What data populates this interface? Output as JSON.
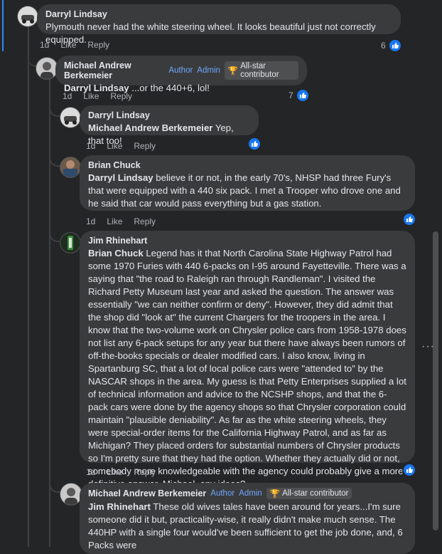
{
  "comments": [
    {
      "author": "Darryl Lindsay",
      "text": "Plymouth never had the white steering wheel. It looks beautiful just not correctly equipped.",
      "time": "1d",
      "like": "Like",
      "reply": "Reply",
      "reactions": "6"
    },
    {
      "author": "Michael Andrew Berkemeier",
      "badge_author": "Author",
      "badge_admin": "Admin",
      "badge_allstar": "All-star contributor",
      "mention": "Darryl Lindsay",
      "text": " ...or the 440+6, lol!",
      "time": "1d",
      "like": "Like",
      "reply": "Reply",
      "reactions": "7"
    },
    {
      "author": "Darryl Lindsay",
      "mention": "Michael Andrew Berkemeier",
      "text": " Yep, that too!",
      "time": "1d",
      "like": "Like",
      "reply": "Reply"
    },
    {
      "author": "Brian Chuck",
      "mention": "Darryl Lindsay",
      "text": " believe it or not, in the early 70's, NHSP had three Fury's that were equipped with a 440 six pack. I met a Trooper who drove one and he said that car would pass everything but a gas station.",
      "time": "1d",
      "like": "Like",
      "reply": "Reply"
    },
    {
      "author": "Jim Rhinehart",
      "mention": "Brian Chuck",
      "text": " Legend has it that North Carolina State Highway Patrol had some 1970 Furies with 440 6-packs on I-95 around Fayetteville. There was a saying that \"the road to Raleigh ran through Randleman\". I visited the Richard Petty Museum last year and asked the question. The answer was essentially \"we can neither confirm or deny\". However, they did admit that the shop did \"look at\" the current Chargers for the troopers in the area. I know that the two-volume work on Chrysler police cars from 1958-1978 does not list any 6-pack setups for any year but there have always been rumors of off-the-books specials or dealer modified cars. I also know, living in Spartanburg SC, that a lot of local police cars were \"attended to\" by the NASCAR shops in the area. My guess is that Petty Enterprises supplied a lot of technical information and advice to the NCSHP shops, and that the 6-pack cars were done by the agency shops so that Chrysler corporation could maintain \"plausible deniability\". As far as the white steering wheels, they were special-order items for the California Highway Patrol, and as far as Michigan? They placed orders for substantial numbers of Chrysler products so I'm pretty sure that they had the option. Whether they actually did or not, somebody more knowledgeable with the agency could probably give a more definitive answer. Michael, any ideas?",
      "time": "1d",
      "like": "Like",
      "reply": "Reply"
    },
    {
      "author": "Michael Andrew Berkemeier",
      "badge_author": "Author",
      "badge_admin": "Admin",
      "badge_allstar": "All-star contributor",
      "mention": "Jim Rhinehart",
      "text": " These old wives tales have been around for years...I'm sure someone did it but, practicality-wise, it really didn't make much sense. The 440HP with a single four would've been sufficient to get the job done, and, 6 Packs were"
    }
  ],
  "icons": {
    "like": "thumbs-up-icon",
    "trophy": "trophy-icon",
    "more": "more-options-icon"
  },
  "colors": {
    "background": "#242526",
    "bubble": "#3a3b3c",
    "link_blue": "#1877f2",
    "badge_blue": "#6ea8ff"
  }
}
